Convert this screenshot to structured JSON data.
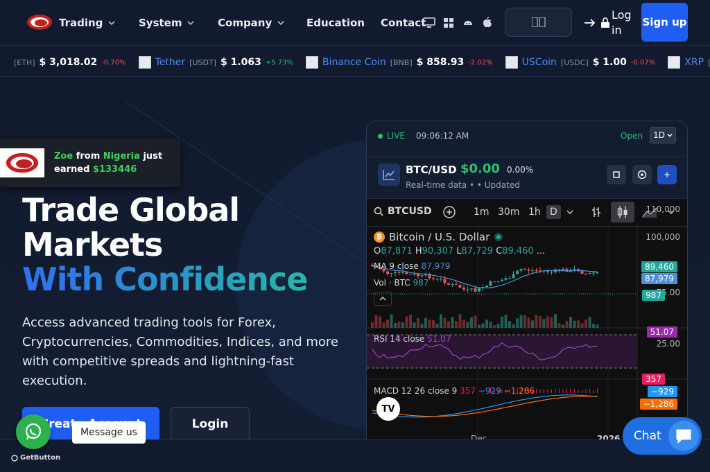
{
  "nav": {
    "items": [
      {
        "label": "Trading",
        "has_dropdown": true
      },
      {
        "label": "System",
        "has_dropdown": true
      },
      {
        "label": "Company",
        "has_dropdown": true
      },
      {
        "label": "Education",
        "has_dropdown": false
      },
      {
        "label": "Contact",
        "has_dropdown": false
      }
    ],
    "language_label": "",
    "login_label": "Log in",
    "signup_label": "Sign up"
  },
  "ticker": [
    {
      "name": "",
      "symbol": "[ETH]",
      "price": "$ 3,018.02",
      "change": "-0.70%",
      "direction": "neg"
    },
    {
      "name": "Tether",
      "symbol": "[USDT]",
      "price": "$ 1.063",
      "change": "+5.73%",
      "direction": "pos"
    },
    {
      "name": "Binance Coin",
      "symbol": "[BNB]",
      "price": "$ 858.93",
      "change": "-2.02%",
      "direction": "neg"
    },
    {
      "name": "USCoin",
      "symbol": "[USDC]",
      "price": "$ 1.00",
      "change": "-0.07%",
      "direction": "neg"
    },
    {
      "name": "XRP",
      "symbol": "[XRP]",
      "price": "$",
      "change": "",
      "direction": "neg"
    }
  ],
  "toast": {
    "name": "Zoe",
    "from_word": "from",
    "country": "Nigeria",
    "tail": "just earned",
    "amount": "$133446"
  },
  "hero": {
    "title_line1": "Trade Global",
    "title_line2": "Markets",
    "title_accent": "With Confidence",
    "description": "Access advanced trading tools for Forex, Cryptocurrencies, Commodities, Indices, and more with competitive spreads and lightning-fast execution.",
    "primary_cta": "Create Account",
    "secondary_cta": "Login"
  },
  "chart_card": {
    "live_label": "LIVE",
    "time": "09:06:12 AM",
    "open_label": "Open",
    "timeframe": "1D",
    "pair": "BTC/USD",
    "price": "$0.00",
    "change": "0.00%",
    "subtitle": "Real-time data  •  • Updated",
    "plus_label": "+"
  },
  "tv": {
    "symbol": "BTCUSD",
    "timeframes": [
      "1m",
      "30m",
      "1h",
      "D"
    ],
    "active_timeframe": "D",
    "title": "Bitcoin / U.S. Dollar",
    "ohlc": {
      "o_label": "O",
      "o": "87,871",
      "h_label": "H",
      "h": "90,307",
      "l_label": "L",
      "l": "87,729",
      "c_label": "C",
      "c": "89,460",
      "more": "..."
    },
    "ma_label": "MA 9 close",
    "ma_value": "87,979",
    "vol_label": "Vol · BTC",
    "vol_value": "987",
    "rsi_label": "RSI 14 close",
    "rsi_value": "51.07",
    "macd_label": "MACD 12 26 close 9",
    "macd_values": [
      "357",
      "−929",
      "−1,286"
    ],
    "price_axis": [
      "110,000",
      "100,000",
      "75.00",
      "25.00"
    ],
    "tags": {
      "last": "89,460",
      "ma": "87,979",
      "vol": "987",
      "rsi": "51.07",
      "macd": "357",
      "signal": "−929",
      "hist": "−1,286"
    },
    "x_axis": [
      "Dec",
      "2026"
    ],
    "logo_text": "TV"
  },
  "widgets": {
    "whatsapp_tip": "Message us",
    "getbutton": "GetButton",
    "chat_label": "Chat"
  },
  "colors": {
    "accent": "#1f5ef3",
    "positive": "#2fbf71",
    "negative": "#f0534f",
    "background": "#111a2e"
  }
}
